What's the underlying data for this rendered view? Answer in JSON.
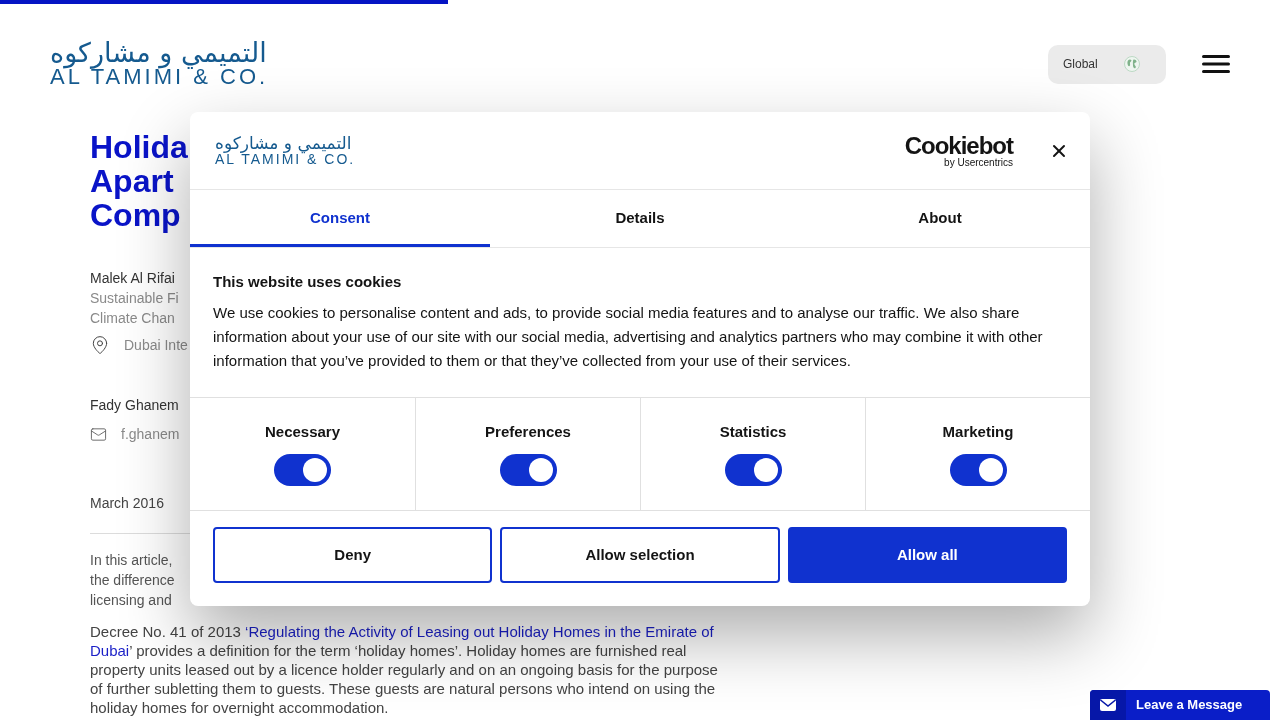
{
  "reading_progress": {
    "level": 0.35
  },
  "header": {
    "logo": {
      "arabic": "التميمي و مشاركوه",
      "english": "AL TAMIMI & CO."
    },
    "region_button": {
      "label": "Global"
    }
  },
  "article": {
    "title_lines": [
      "Holida",
      "Apart",
      "Comp"
    ],
    "authors": [
      {
        "name": "Malek Al Rifai",
        "roles": [
          "Sustainable Fi",
          "Climate Chan"
        ],
        "contact": {
          "kind": "location",
          "text": "Dubai Inte"
        }
      },
      {
        "name": "Fady Ghanem",
        "contact": {
          "kind": "email",
          "text": "f.ghanem"
        }
      }
    ],
    "date": "March 2016",
    "intro_lines": [
      "In this article,",
      "the difference",
      "licensing and"
    ],
    "paragraph": [
      {
        "kind": "text",
        "text": "Decree No. 41 of 2013 "
      },
      {
        "kind": "link",
        "text": "‘Regulating the Activity of Leasing out Holiday Homes in the Emirate of Dubai"
      },
      {
        "kind": "text",
        "text": "’ provides a definition for the term ‘holiday homes’. Holiday homes are furnished real property units leased out by a licence holder regularly and on an ongoing basis for the purpose of further subletting them to guests. These guests are natural persons who intend on using the holiday homes for overnight accommodation."
      }
    ]
  },
  "cookie_dialog": {
    "logo": {
      "arabic": "التميمي و مشاركوه",
      "english": "AL TAMIMI & CO."
    },
    "provider": {
      "name": "Cookiebot",
      "byline": "by Usercentrics"
    },
    "tabs": [
      {
        "label": "Consent",
        "selected": true
      },
      {
        "label": "Details",
        "selected": false
      },
      {
        "label": "About",
        "selected": false
      }
    ],
    "heading": "This website uses cookies",
    "body": "We use cookies to personalise content and ads, to provide social media features and to analyse our traffic. We also share information about your use of our site with our social media, advertising and analytics partners who may combine it with other information that you’ve provided to them or that they’ve collected from your use of their services.",
    "categories": [
      {
        "label": "Necessary",
        "on": true
      },
      {
        "label": "Preferences",
        "on": true
      },
      {
        "label": "Statistics",
        "on": true
      },
      {
        "label": "Marketing",
        "on": true
      }
    ],
    "buttons": [
      {
        "label": "Deny",
        "kind": "outline"
      },
      {
        "label": "Allow selection",
        "kind": "outline"
      },
      {
        "label": "Allow all",
        "kind": "filled"
      }
    ]
  },
  "chat_widget": {
    "label": "Leave a Message"
  }
}
